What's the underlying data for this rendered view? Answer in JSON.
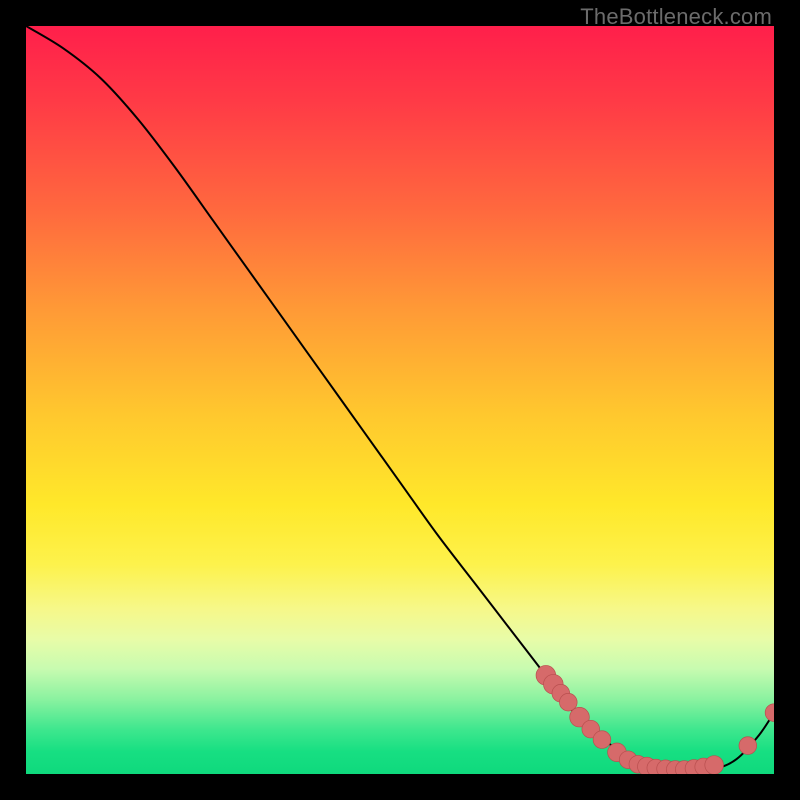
{
  "attribution": "TheBottleneck.com",
  "colors": {
    "curve_stroke": "#000000",
    "marker_fill": "#d66a6a",
    "marker_stroke": "#b94f4f",
    "background": "#000000"
  },
  "chart_data": {
    "type": "line",
    "title": "",
    "xlabel": "",
    "ylabel": "",
    "xlim": [
      0,
      100
    ],
    "ylim": [
      0,
      100
    ],
    "grid": false,
    "legend": false,
    "series": [
      {
        "name": "curve",
        "x": [
          0,
          5,
          10,
          15,
          20,
          25,
          30,
          35,
          40,
          45,
          50,
          55,
          60,
          65,
          70,
          73,
          76,
          80,
          84,
          88,
          92,
          95,
          98,
          100
        ],
        "y": [
          100,
          97,
          93,
          87.5,
          81,
          74,
          67,
          60,
          53,
          46,
          39,
          32,
          25.5,
          19,
          12.5,
          8.5,
          5.5,
          2.8,
          1.2,
          0.6,
          0.7,
          2.0,
          5.2,
          8.2
        ]
      }
    ],
    "markers": [
      {
        "x": 69.5,
        "y": 13.2,
        "r": 1.4
      },
      {
        "x": 70.5,
        "y": 12.0,
        "r": 1.4
      },
      {
        "x": 71.5,
        "y": 10.8,
        "r": 1.2
      },
      {
        "x": 72.5,
        "y": 9.6,
        "r": 1.2
      },
      {
        "x": 74.0,
        "y": 7.6,
        "r": 1.4
      },
      {
        "x": 75.5,
        "y": 6.0,
        "r": 1.2
      },
      {
        "x": 77.0,
        "y": 4.6,
        "r": 1.2
      },
      {
        "x": 79.0,
        "y": 2.9,
        "r": 1.3
      },
      {
        "x": 80.5,
        "y": 1.9,
        "r": 1.2
      },
      {
        "x": 81.8,
        "y": 1.3,
        "r": 1.2
      },
      {
        "x": 83.0,
        "y": 1.0,
        "r": 1.3
      },
      {
        "x": 84.2,
        "y": 0.8,
        "r": 1.2
      },
      {
        "x": 85.5,
        "y": 0.7,
        "r": 1.2
      },
      {
        "x": 86.8,
        "y": 0.6,
        "r": 1.2
      },
      {
        "x": 88.0,
        "y": 0.6,
        "r": 1.2
      },
      {
        "x": 89.3,
        "y": 0.75,
        "r": 1.2
      },
      {
        "x": 90.6,
        "y": 0.95,
        "r": 1.2
      },
      {
        "x": 92.0,
        "y": 1.2,
        "r": 1.3
      },
      {
        "x": 96.5,
        "y": 3.8,
        "r": 1.2
      },
      {
        "x": 100.0,
        "y": 8.2,
        "r": 1.2
      }
    ]
  }
}
